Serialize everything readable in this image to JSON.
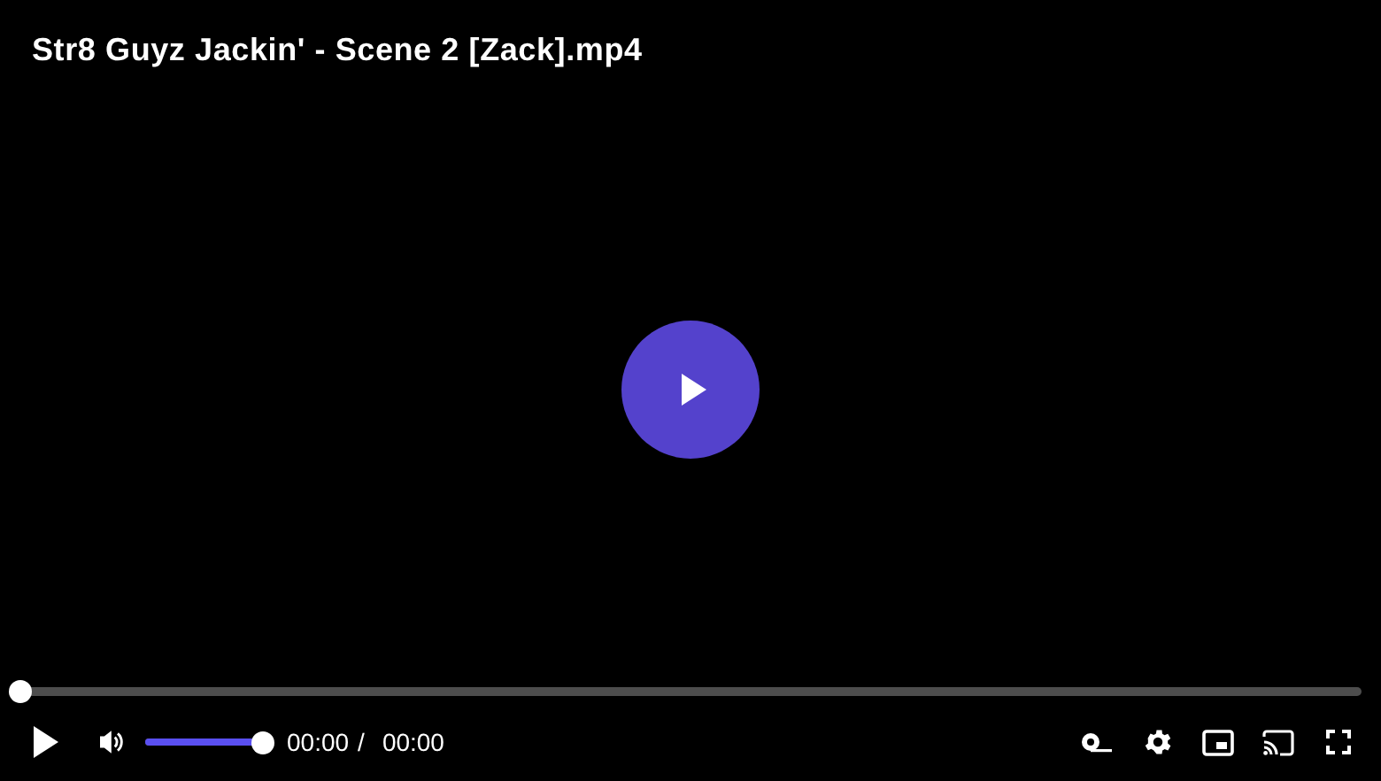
{
  "title": "Str8 Guyz Jackin' - Scene 2 [Zack].mp4",
  "playing": false,
  "progress": {
    "level": 0
  },
  "volume": {
    "level": 1,
    "muted": false
  },
  "time": {
    "current": "00:00",
    "separator": "/",
    "duration": "00:00"
  }
}
